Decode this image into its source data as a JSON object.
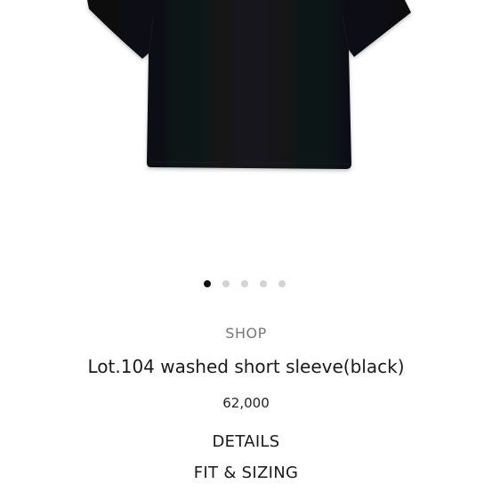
{
  "product": {
    "category": "SHOP",
    "title": "Lot.104 washed short sleeve(black)",
    "price": "62,000",
    "image_alt": "black short sleeve t-shirt",
    "garment_color": "#0d0f12"
  },
  "carousel": {
    "total": 5,
    "active_index": 0
  },
  "links": {
    "details": "DETAILS",
    "fit_sizing": "FIT & SIZING"
  },
  "colors": {
    "dot_active": "#111111",
    "dot_inactive": "#d3d3d3"
  }
}
